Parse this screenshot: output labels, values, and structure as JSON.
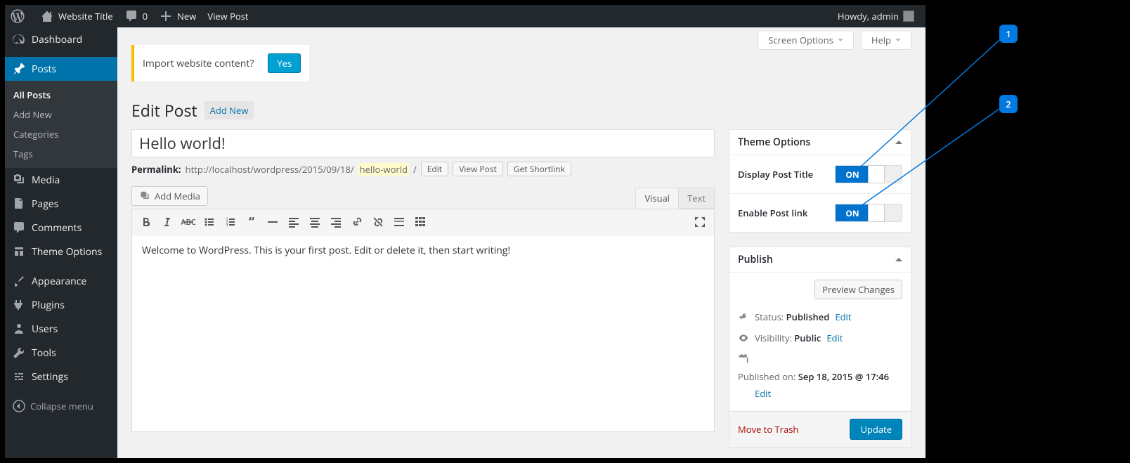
{
  "adminbar": {
    "site_title": "Website Title",
    "comments_count": "0",
    "new_label": "New",
    "view_post": "View Post",
    "howdy": "Howdy, admin"
  },
  "menu": {
    "dashboard": "Dashboard",
    "posts": "Posts",
    "posts_sub": {
      "all": "All Posts",
      "add": "Add New",
      "categories": "Categories",
      "tags": "Tags"
    },
    "media": "Media",
    "pages": "Pages",
    "comments": "Comments",
    "theme_options": "Theme Options",
    "appearance": "Appearance",
    "plugins": "Plugins",
    "users": "Users",
    "tools": "Tools",
    "settings": "Settings",
    "collapse": "Collapse menu"
  },
  "screen_meta": {
    "screen_options": "Screen Options",
    "help": "Help"
  },
  "notice": {
    "text": "Import website content?",
    "yes": "Yes"
  },
  "heading": {
    "title": "Edit Post",
    "add_new": "Add New"
  },
  "post": {
    "title_value": "Hello world!",
    "permalink_label": "Permalink:",
    "permalink_base": "http://localhost/wordpress/2015/09/18/",
    "permalink_slug": "hello-world",
    "permalink_trail": "/",
    "btn_edit": "Edit",
    "btn_view": "View Post",
    "btn_shortlink": "Get Shortlink",
    "add_media": "Add Media",
    "tab_visual": "Visual",
    "tab_text": "Text",
    "content": "Welcome to WordPress. This is your first post. Edit or delete it, then start writing!"
  },
  "theme_box": {
    "title": "Theme Options",
    "option1": "Display Post Title",
    "option2": "Enable Post link",
    "on": "ON"
  },
  "publish": {
    "title": "Publish",
    "preview": "Preview Changes",
    "status_label": "Status:",
    "status_value": "Published",
    "visibility_label": "Visibility:",
    "visibility_value": "Public",
    "published_label": "Published on:",
    "published_value": "Sep 18, 2015 @ 17:46",
    "edit": "Edit",
    "trash": "Move to Trash",
    "update": "Update"
  },
  "callouts": {
    "b1": "1",
    "b2": "2"
  }
}
